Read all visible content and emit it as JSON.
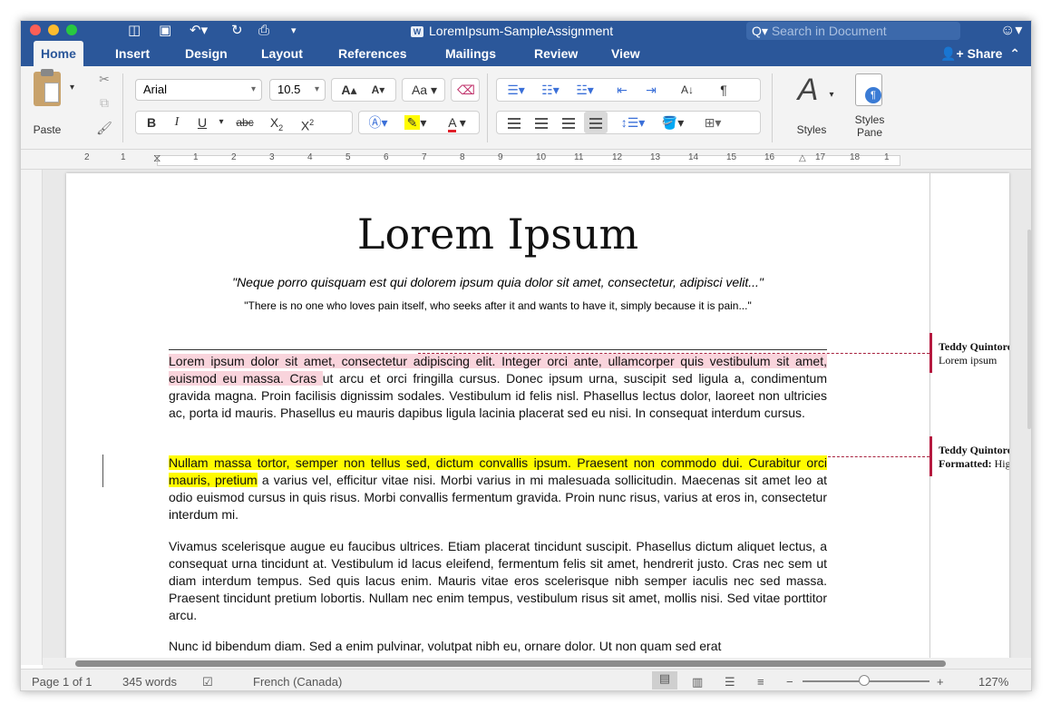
{
  "window": {
    "title": "LoremIpsum-SampleAssignment",
    "search_placeholder": "Search in Document"
  },
  "tabs": [
    "Home",
    "Insert",
    "Design",
    "Layout",
    "References",
    "Mailings",
    "Review",
    "View"
  ],
  "share_label": "Share",
  "ribbon": {
    "paste_label": "Paste",
    "font_name": "Arial",
    "font_size": "10.5",
    "styles_label": "Styles",
    "styles_pane_label": "Styles\nPane"
  },
  "ruler_numbers": [
    "2",
    "1",
    "1",
    "2",
    "3",
    "4",
    "5",
    "6",
    "7",
    "8",
    "9",
    "10",
    "11",
    "12",
    "13",
    "14",
    "15",
    "16",
    "17",
    "18",
    "1"
  ],
  "document": {
    "heading": "Lorem Ipsum",
    "quote1": "\"Neque porro quisquam est qui dolorem ipsum quia dolor sit amet, consectetur, adipisci velit...\"",
    "quote2": "\"There is no one who loves pain itself, who seeks after it and wants to have it, simply because it is pain...\"",
    "p1_highlight": "Lorem ipsum dolor sit amet, consectetur adipiscing elit. Integer orci ante, ullamcorper quis vestibulum sit amet, euismod eu massa. Cras ",
    "p1_rest": "ut arcu et orci fringilla cursus. Donec ipsum urna, suscipit sed ligula a, condimentum gravida magna. Proin facilisis dignissim sodales. Vestibulum id felis nisl. Phasellus lectus dolor, laoreet non ultricies ac, porta id mauris. Phasellus eu mauris dapibus ligula lacinia placerat sed eu nisi. In consequat interdum cursus.",
    "p2_highlight": "Nullam massa tortor, semper non tellus sed, dictum convallis ipsum. Praesent non commodo dui. Curabitur orci mauris, pretium",
    "p2_rest": " a varius vel, efficitur vitae nisi. Morbi varius in mi malesuada sollicitudin. Maecenas sit amet leo at odio euismod cursus in quis risus. Morbi convallis fermentum gravida. Proin nunc risus, varius at eros in, consectetur interdum mi.",
    "p3": "Vivamus scelerisque augue eu faucibus ultrices. Etiam placerat tincidunt suscipit. Phasellus dictum aliquet lectus, a consequat urna tincidunt at. Vestibulum id lacus eleifend, fermentum felis sit amet, hendrerit justo. Cras nec sem ut diam interdum tempus. Sed quis lacus enim. Mauris vitae eros scelerisque nibh semper iaculis nec sed massa. Praesent tincidunt pretium lobortis. Nullam nec enim tempus, vestibulum risus sit amet, mollis nisi. Sed vitae porttitor arcu.",
    "p4": "Nunc id bibendum diam. Sed a enim pulvinar, volutpat nibh eu, ornare dolor. Ut non quam sed erat"
  },
  "comments": [
    {
      "author": "Teddy Quintoro",
      "text": "Lorem ipsum"
    },
    {
      "author": "Teddy Quintoro",
      "prefix": "Formatted:",
      "text": " Higl"
    }
  ],
  "status": {
    "page": "Page 1 of 1",
    "words": "345 words",
    "language": "French (Canada)",
    "zoom": "127%"
  },
  "colors": {
    "title_bar": "#2b579a",
    "comment_marker": "#b5193f",
    "highlight_yellow": "#fffb00",
    "highlight_pink": "#f9d4dc"
  }
}
